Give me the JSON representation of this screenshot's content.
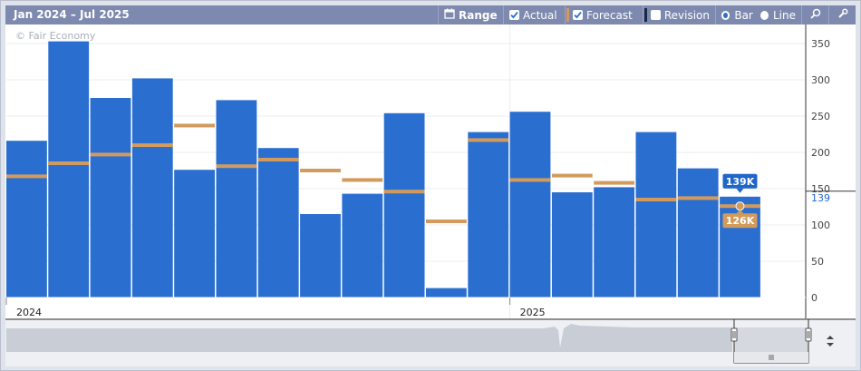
{
  "toolbar": {
    "title": "Jan 2024 – Jul 2025",
    "range_label": "Range",
    "actual_label": "Actual",
    "forecast_label": "Forecast",
    "revision_label": "Revision",
    "bar_label": "Bar",
    "line_label": "Line",
    "actual_checked": true,
    "forecast_checked": true,
    "revision_checked": false,
    "chart_type_selected": "Bar"
  },
  "watermark": "© Fair Economy",
  "colors": {
    "actual": "#2a6fd0",
    "forecast": "#d29b5d",
    "toolbar": "#7d89ae",
    "background": "#dfe3ec",
    "current_label": "#1f66c7"
  },
  "chart_data": {
    "type": "bar",
    "categories": [
      "Jan 2024",
      "Feb 2024",
      "Mar 2024",
      "Apr 2024",
      "May 2024",
      "Jun 2024",
      "Jul 2024",
      "Aug 2024",
      "Sep 2024",
      "Oct 2024",
      "Nov 2024",
      "Dec 2024",
      "Jan 2025",
      "Feb 2025",
      "Mar 2025",
      "Apr 2025",
      "May 2025",
      "Jun 2025",
      "Jul 2025"
    ],
    "series": [
      {
        "key": "actual",
        "values": [
          216,
          353,
          275,
          302,
          176,
          272,
          206,
          115,
          143,
          254,
          13,
          228,
          256,
          145,
          152,
          228,
          178,
          139
        ]
      },
      {
        "key": "forecast",
        "values": [
          167,
          185,
          197,
          210,
          237,
          181,
          190,
          175,
          162,
          146,
          105,
          217,
          162,
          168,
          158,
          135,
          137,
          126
        ]
      }
    ],
    "ylim": [
      0,
      370
    ],
    "yticks": [
      0,
      50,
      100,
      150,
      200,
      250,
      300,
      350
    ],
    "x_year_labels": [
      {
        "label": "2024",
        "index": 0
      },
      {
        "label": "2025",
        "index": 12
      }
    ],
    "current_actual_label": "139K",
    "current_forecast_label": "126K",
    "current_value_marker": "139",
    "grid": true
  }
}
